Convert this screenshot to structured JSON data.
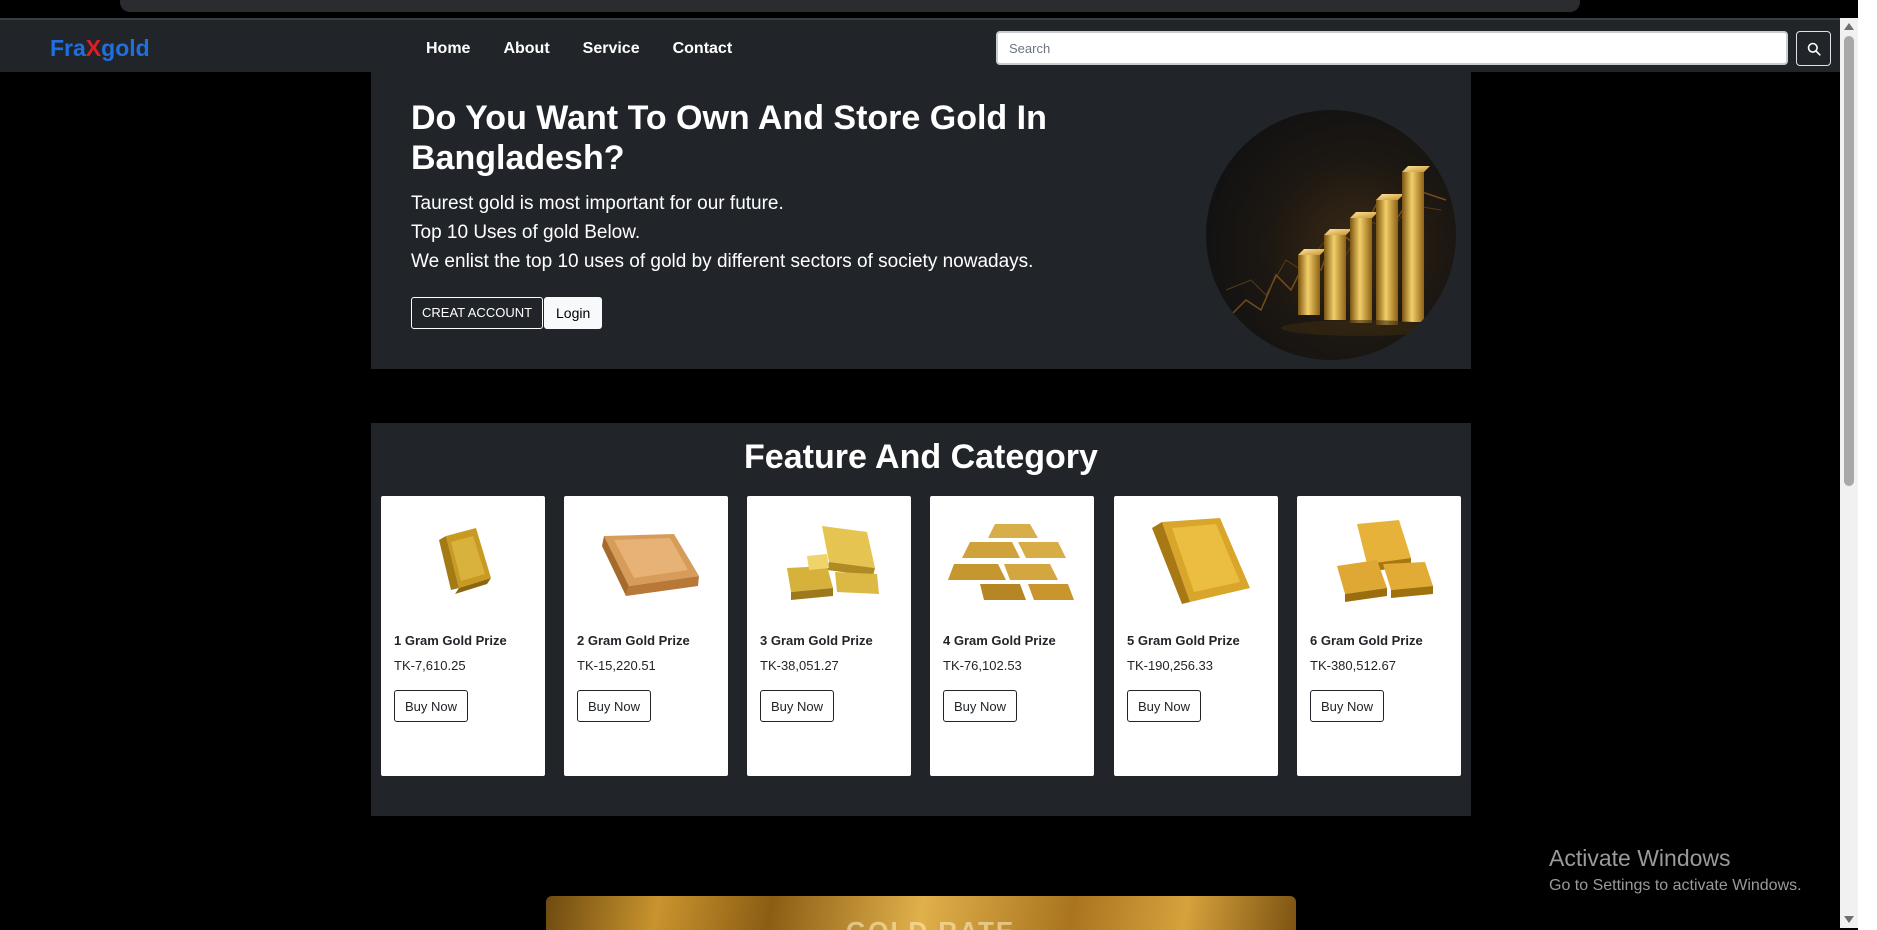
{
  "navbar": {
    "brand": {
      "part1": "Fra",
      "part2": "X",
      "part3": "gold"
    },
    "links": [
      "Home",
      "About",
      "Service",
      "Contact"
    ],
    "search_placeholder": "Search"
  },
  "hero": {
    "title": "Do You Want To Own And Store Gold In Bangladesh?",
    "line1": "Taurest gold is most important for our future.",
    "line2": "Top 10 Uses of gold Below.",
    "line3": "We enlist the top 10 uses of gold by different sectors of society nowadays.",
    "create_account_label": "CREAT ACCOUNT",
    "login_label": "Login"
  },
  "features": {
    "title": "Feature And Category",
    "cards": [
      {
        "title": "1 Gram Gold Prize",
        "price": "TK-7,610.25",
        "button": "Buy Now"
      },
      {
        "title": "2 Gram Gold Prize",
        "price": "TK-15,220.51",
        "button": "Buy Now"
      },
      {
        "title": "3 Gram Gold Prize",
        "price": "TK-38,051.27",
        "button": "Buy Now"
      },
      {
        "title": "4 Gram Gold Prize",
        "price": "TK-76,102.53",
        "button": "Buy Now"
      },
      {
        "title": "5 Gram Gold Prize",
        "price": "TK-190,256.33",
        "button": "Buy Now"
      },
      {
        "title": "6 Gram Gold Prize",
        "price": "TK-380,512.67",
        "button": "Buy Now"
      }
    ]
  },
  "banner": {
    "text": "GOLD RATE"
  },
  "watermark": {
    "line1": "Activate Windows",
    "line2": "Go to Settings to activate Windows."
  },
  "colors": {
    "navbar_bg": "#212529",
    "brand_blue": "#1f6fe0",
    "brand_red": "#e01c24",
    "page_bg": "#000000",
    "gold": "#d4a233"
  },
  "icons": {
    "search_button": "search-icon"
  }
}
